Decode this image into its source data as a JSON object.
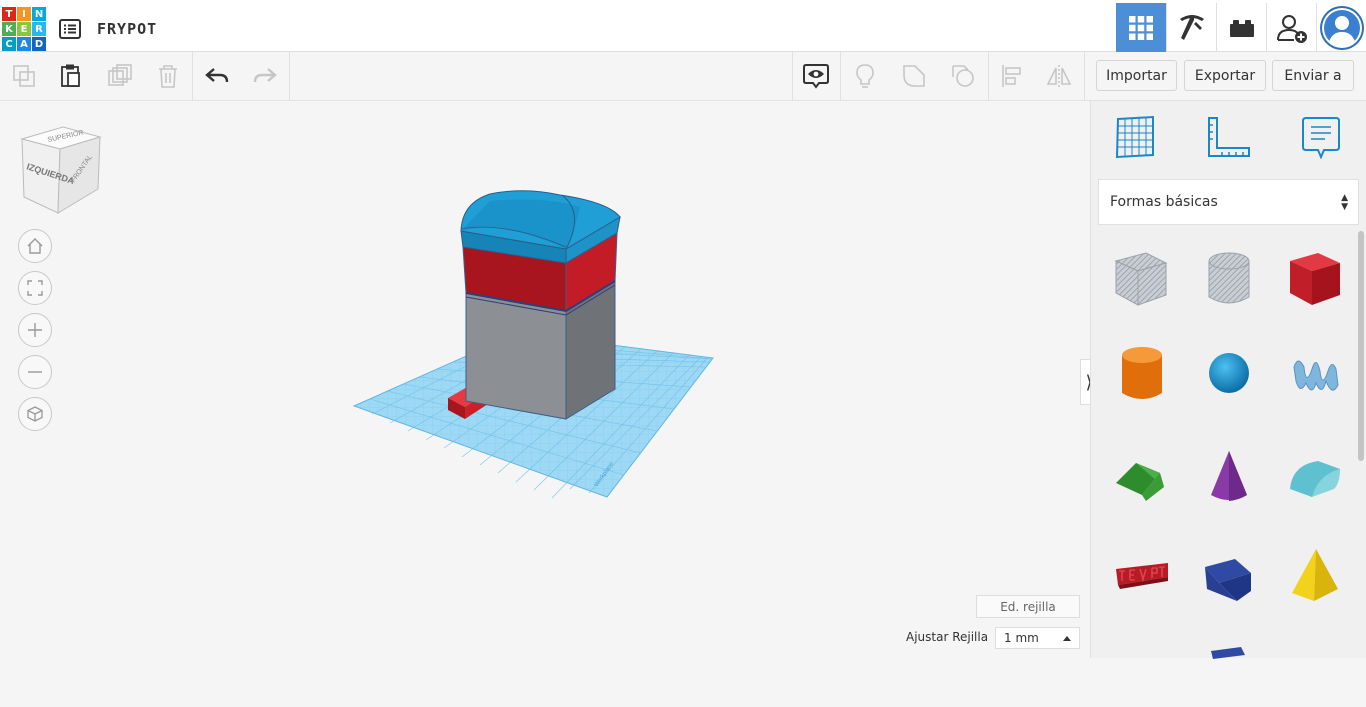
{
  "header": {
    "logo_letters": [
      "T",
      "I",
      "N",
      "K",
      "E",
      "R",
      "C",
      "A",
      "D"
    ],
    "project_name": "FRYPOT"
  },
  "toolbar": {
    "import_label": "Importar",
    "export_label": "Exportar",
    "send_label": "Enviar a"
  },
  "viewcube": {
    "top": "SUPERIOR",
    "left": "IZQUIERDA",
    "front": "FRONTAL"
  },
  "workplane": {
    "edit_grid_label": "Ed. rejilla",
    "snap_label": "Ajustar Rejilla",
    "snap_value": "1 mm",
    "watermark": "Workplane"
  },
  "panel": {
    "category": "Formas básicas",
    "shapes": [
      {
        "name": "box-hole",
        "color": "#b9c0c8"
      },
      {
        "name": "cylinder-hole",
        "color": "#b9c0c8"
      },
      {
        "name": "box",
        "color": "#d91f2a"
      },
      {
        "name": "cylinder",
        "color": "#f07f10"
      },
      {
        "name": "sphere",
        "color": "#1a9ad6"
      },
      {
        "name": "scribble",
        "color": "#7ab3d8"
      },
      {
        "name": "roof",
        "color": "#3aa335"
      },
      {
        "name": "cone",
        "color": "#8e3aa8"
      },
      {
        "name": "round-roof",
        "color": "#6fc9d4"
      },
      {
        "name": "text",
        "color": "#c01f2a"
      },
      {
        "name": "wedge",
        "color": "#253b8f"
      },
      {
        "name": "pyramid",
        "color": "#f1cf1a"
      }
    ]
  },
  "colors": {
    "accent": "#4d8fd6",
    "grid": "#8fd1f1",
    "dome": "#1b8fc4",
    "band": "#b31c24",
    "body": "#8a8d91"
  }
}
